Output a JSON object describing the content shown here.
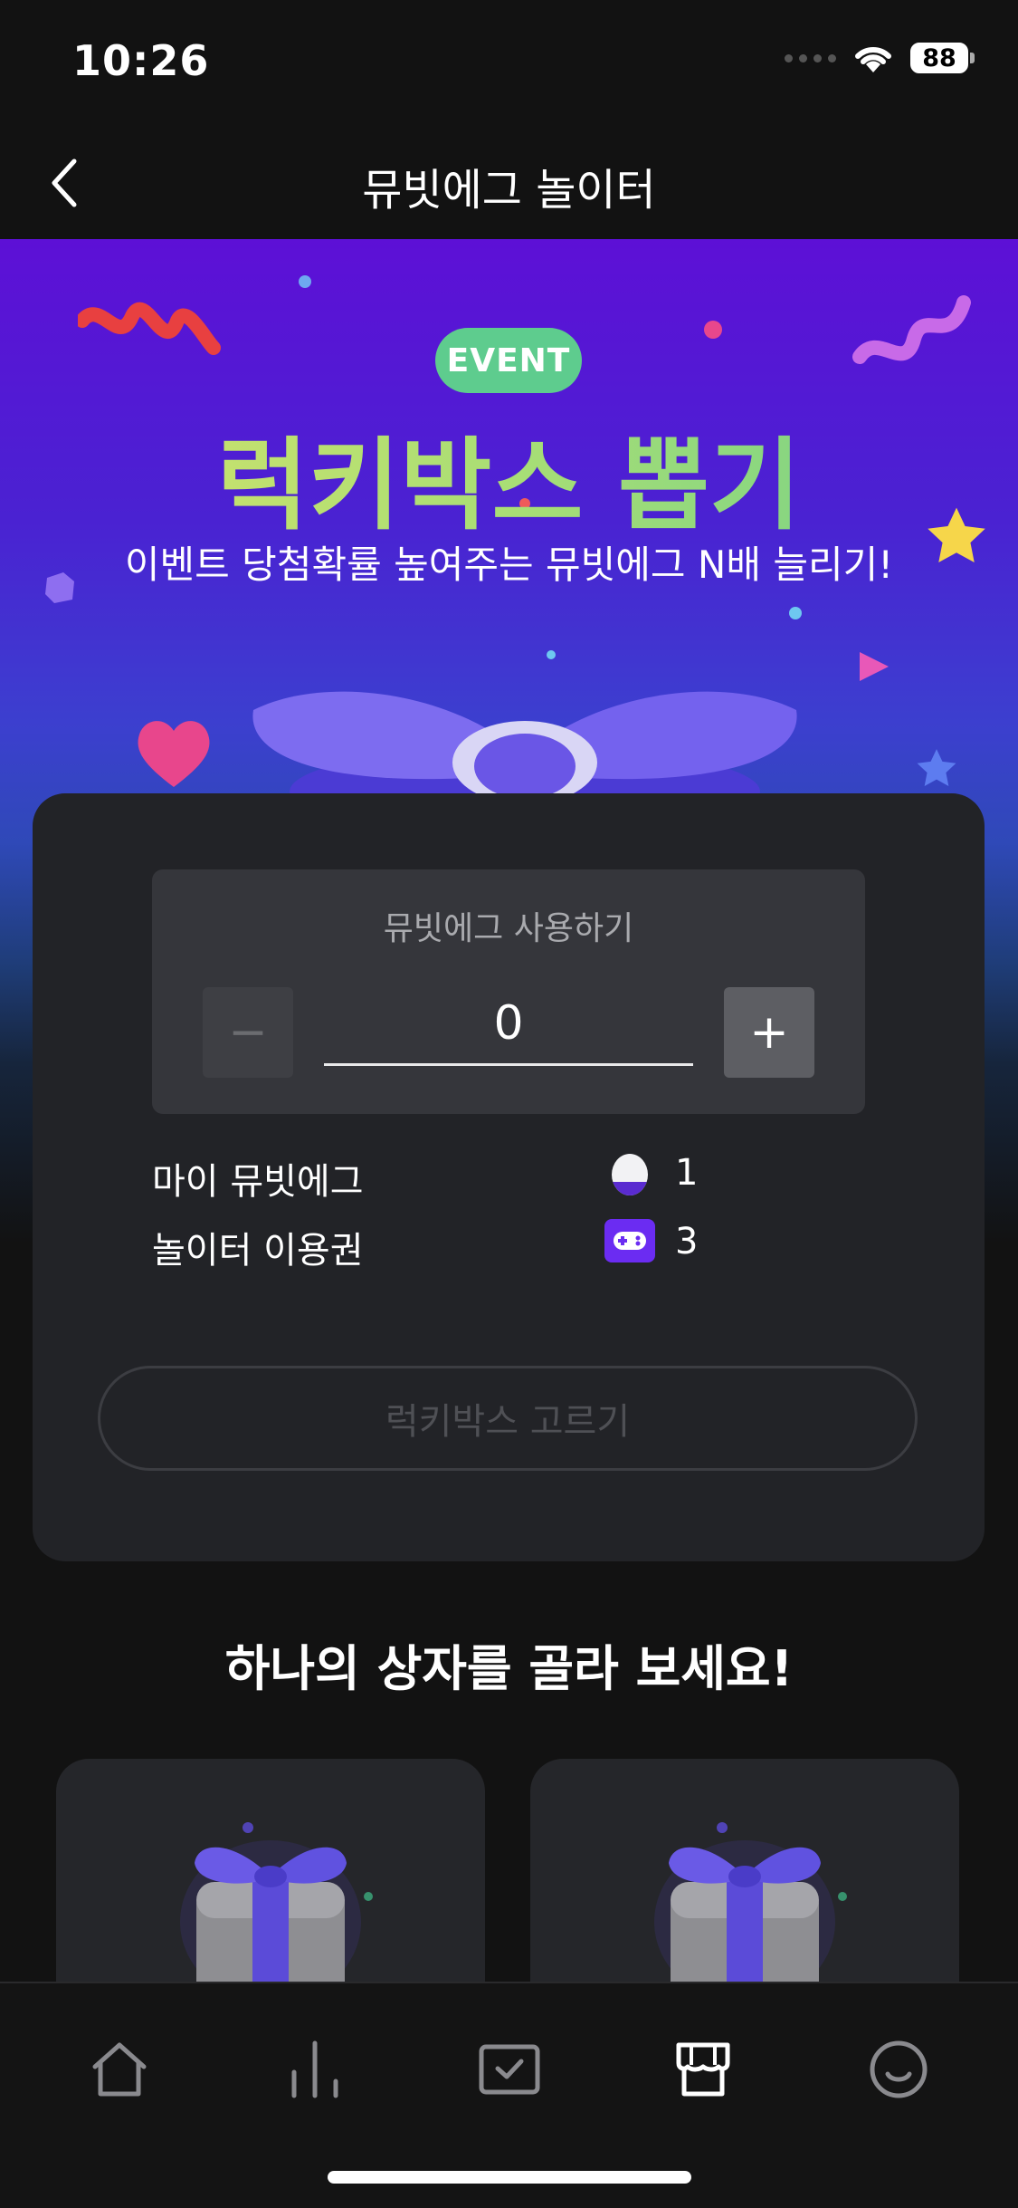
{
  "status_bar": {
    "time": "10:26",
    "battery": "88"
  },
  "nav": {
    "title": "뮤빗에그 놀이터",
    "back_icon": "chevron-left-icon"
  },
  "hero": {
    "badge": "EVENT",
    "title": "럭키박스 뽑기",
    "subtitle": "이벤트 당첨확률 높여주는 뮤빗에그 N배 늘리기!"
  },
  "card": {
    "egg_panel_label": "뮤빗에그 사용하기",
    "minus_label": "−",
    "plus_label": "+",
    "egg_count_value": "0",
    "my_egg_label": "마이 뮤빗에그",
    "my_egg_value": "1",
    "ticket_label": "놀이터 이용권",
    "ticket_value": "3",
    "pick_button_label": "럭키박스 고르기"
  },
  "prompt": {
    "title": "하나의 상자를 골라 보세요!"
  },
  "boxes": [
    {
      "icon": "gift-box-icon"
    },
    {
      "icon": "gift-box-icon"
    }
  ],
  "tab_bar": {
    "tabs": [
      {
        "icon": "home-icon"
      },
      {
        "icon": "chart-icon"
      },
      {
        "icon": "vote-box-icon"
      },
      {
        "icon": "store-icon",
        "active": true
      },
      {
        "icon": "smile-icon"
      }
    ]
  },
  "colors": {
    "badge_green": "#5ecc8e",
    "card_bg": "#222327",
    "accent_purple": "#6b3cf0"
  }
}
